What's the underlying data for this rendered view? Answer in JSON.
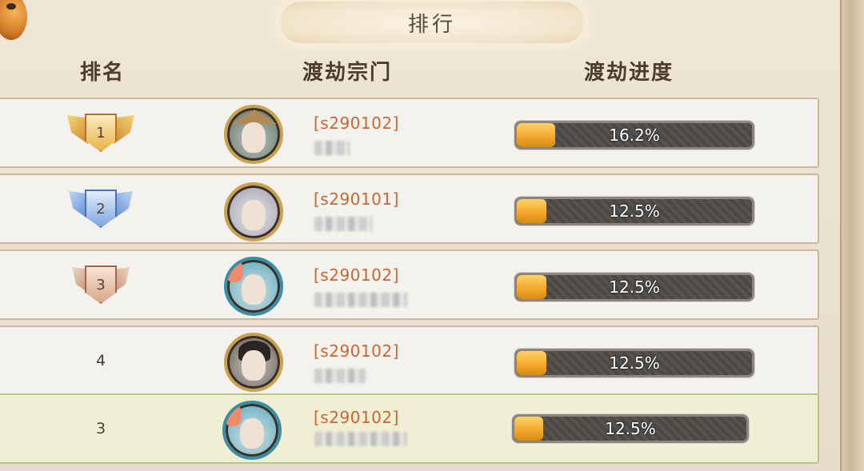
{
  "title": "排行",
  "headers": {
    "rank": "排名",
    "sect": "渡劫宗门",
    "progress": "渡劫进度"
  },
  "rows": [
    {
      "rank": "1",
      "server": "[s290102]",
      "progress_text": "16.2%",
      "progress": 0.162,
      "medal": "gold",
      "avatar": "hat-hero-avatar"
    },
    {
      "rank": "2",
      "server": "[s290101]",
      "progress_text": "12.5%",
      "progress": 0.125,
      "medal": "silver",
      "avatar": "white-hair-avatar"
    },
    {
      "rank": "3",
      "server": "[s290102]",
      "progress_text": "12.5%",
      "progress": 0.125,
      "medal": "bronze",
      "avatar": "phoenix-avatar"
    },
    {
      "rank": "4",
      "server": "[s290102]",
      "progress_text": "12.5%",
      "progress": 0.125,
      "medal": "none",
      "avatar": "dark-hair-avatar"
    },
    {
      "rank": "3",
      "server": "[s290102]",
      "progress_text": "12.5%",
      "progress": 0.125,
      "medal": "none",
      "avatar": "phoenix-avatar",
      "self": true
    }
  ],
  "colors": {
    "server_tag": "#c8672f",
    "bar_fill": "#f3a92c",
    "self_row": "#f1efd3",
    "gold": "#e7b64a",
    "silver": "#7fa6e0",
    "bronze": "#d8a88a"
  }
}
